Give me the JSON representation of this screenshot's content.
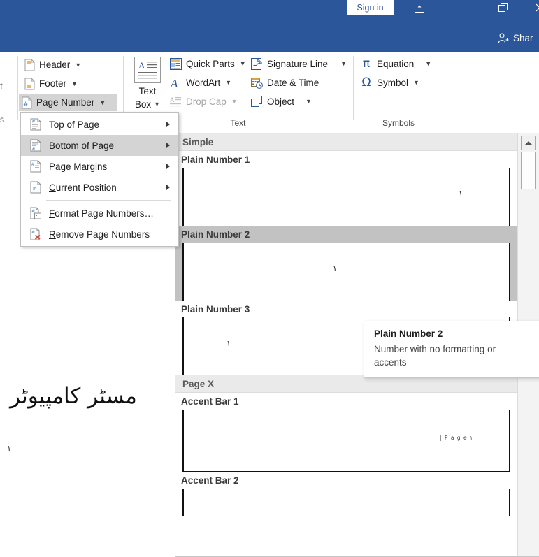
{
  "titlebar": {
    "sign_in_label": "Sign in",
    "ribbon_display_icon": "ribbon-display-options-icon",
    "minimize_icon": "minimize-icon",
    "restore_icon": "restore-icon",
    "close_icon": "close-icon",
    "share_label": "Shar",
    "share_icon": "person-add-icon",
    "bg_color": "#2b579a"
  },
  "ribbon": {
    "left_partial": {
      "label_cut": "t",
      "group_label_cut": "s"
    },
    "header_footer_group": {
      "items": [
        {
          "label": "Header",
          "icon": "header-page-icon",
          "has_caret": true,
          "active": false
        },
        {
          "label": "Footer",
          "icon": "footer-page-icon",
          "has_caret": true,
          "active": false
        },
        {
          "label": "Page Number",
          "icon": "page-number-icon",
          "has_caret": true,
          "active": true
        }
      ]
    },
    "text_group": {
      "label": "Text",
      "text_box": {
        "label_line1": "Text",
        "label_line2": "Box",
        "icon": "text-box-icon",
        "has_caret": true
      },
      "items": [
        {
          "label": "Quick Parts",
          "icon": "quick-parts-icon",
          "has_caret": true,
          "disabled": false
        },
        {
          "label": "WordArt",
          "icon": "wordart-icon",
          "has_caret": true,
          "disabled": false
        },
        {
          "label": "Drop Cap",
          "icon": "drop-cap-icon",
          "has_caret": true,
          "disabled": true
        },
        {
          "label": "Signature Line",
          "icon": "signature-line-icon",
          "has_caret": true,
          "disabled": false
        },
        {
          "label": "Date & Time",
          "icon": "date-time-icon",
          "has_caret": false,
          "disabled": false
        },
        {
          "label": "Object",
          "icon": "object-icon",
          "has_caret": true,
          "disabled": false
        }
      ]
    },
    "symbols_group": {
      "label": "Symbols",
      "items": [
        {
          "label": "Equation",
          "glyph": "π",
          "icon": "equation-icon",
          "has_caret": true
        },
        {
          "label": "Symbol",
          "glyph": "Ω",
          "icon": "symbol-omega-icon",
          "has_caret": true
        }
      ]
    }
  },
  "page_number_menu": {
    "items": [
      {
        "label_pre": "",
        "accel": "T",
        "label_post": "op of Page",
        "icon": "page-number-top-icon",
        "submenu": true,
        "highlighted": false
      },
      {
        "label_pre": "",
        "accel": "B",
        "label_post": "ottom of Page",
        "icon": "page-number-bottom-icon",
        "submenu": true,
        "highlighted": true
      },
      {
        "label_pre": "",
        "accel": "P",
        "label_post": "age Margins",
        "icon": "page-number-margins-icon",
        "submenu": true,
        "highlighted": false
      },
      {
        "label_pre": "",
        "accel": "C",
        "label_post": "urrent Position",
        "icon": "page-number-current-icon",
        "submenu": true,
        "highlighted": false
      },
      {
        "separator": true
      },
      {
        "label_pre": "",
        "accel": "F",
        "label_post": "ormat Page Numbers…",
        "icon": "format-page-numbers-icon",
        "submenu": false,
        "highlighted": false
      },
      {
        "label_pre": "",
        "accel": "R",
        "label_post": "emove Page Numbers",
        "icon": "remove-page-numbers-icon",
        "submenu": false,
        "highlighted": false
      }
    ]
  },
  "document": {
    "watermark_text": "مسٹر کامپیوٹر",
    "page_mark": "١"
  },
  "gallery": {
    "sections": [
      {
        "category": "Simple",
        "items": [
          {
            "name": "Plain Number 1",
            "selected": false,
            "style": "plain",
            "align": "right",
            "mark": "١"
          },
          {
            "name": "Plain Number 2",
            "selected": true,
            "style": "plain",
            "align": "center",
            "mark": "١"
          },
          {
            "name": "Plain Number 3",
            "selected": false,
            "style": "plain",
            "align": "left",
            "mark": "١"
          }
        ]
      },
      {
        "category": "Page X",
        "items": [
          {
            "name": "Accent Bar 1",
            "selected": false,
            "style": "accent",
            "align": "right",
            "mark": "| P a g e ١"
          },
          {
            "name": "Accent Bar 2",
            "selected": false,
            "style": "accent-partial",
            "align": "left",
            "mark": ""
          }
        ]
      }
    ],
    "scrollbar": {
      "up_arrow_icon": "scroll-up-arrow-icon",
      "thumb": "scrollbar-thumb"
    }
  },
  "tooltip": {
    "title": "Plain Number 2",
    "description": "Number with no formatting or accents"
  }
}
